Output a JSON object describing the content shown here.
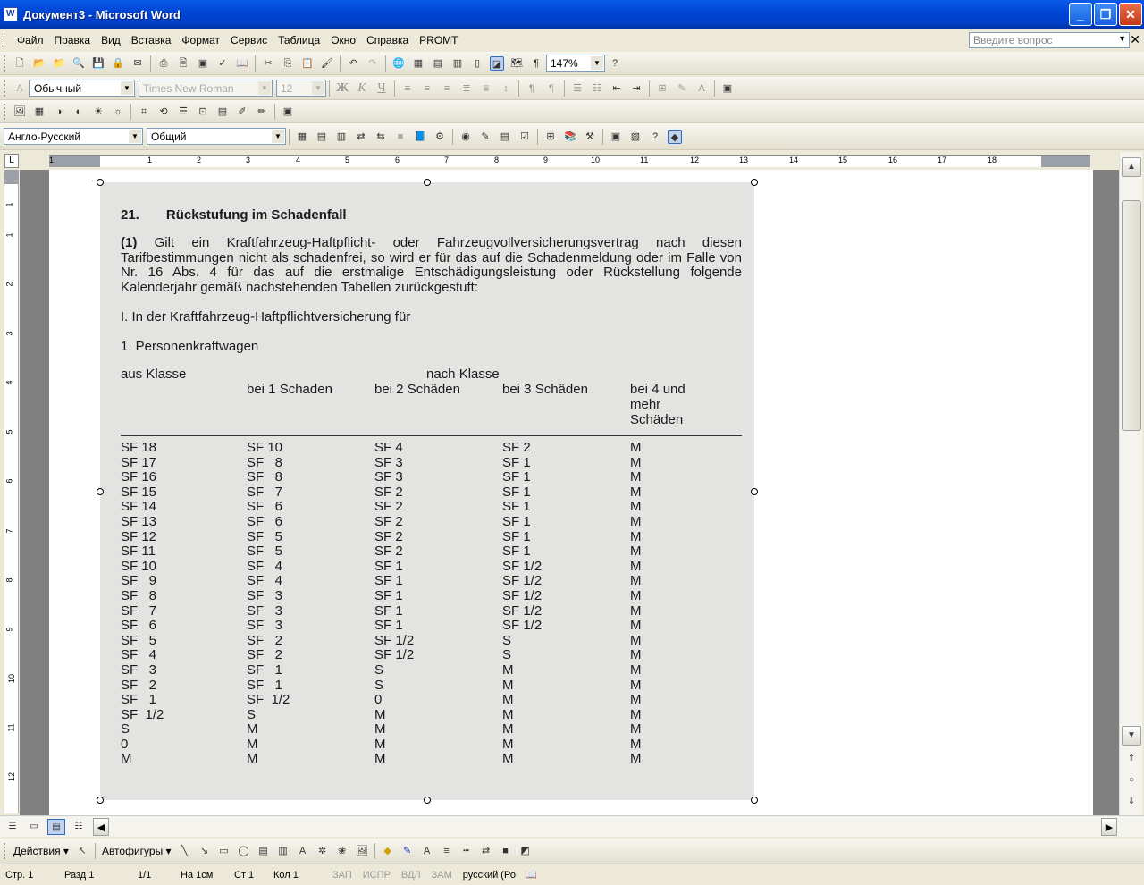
{
  "window": {
    "title": "Документ3 - Microsoft Word"
  },
  "menu": {
    "items": [
      "Файл",
      "Правка",
      "Вид",
      "Вставка",
      "Формат",
      "Сервис",
      "Таблица",
      "Окно",
      "Справка",
      "PROMT"
    ],
    "help_placeholder": "Введите вопрос"
  },
  "toolbar": {
    "zoom": "147%",
    "style": "Обычный",
    "font": "Times New Roman",
    "size": "12",
    "bold": "Ж",
    "italic": "К",
    "underline": "Ч",
    "translate_direction": "Англо-Русский",
    "dictionary": "Общий"
  },
  "ruler": {
    "numbers": [
      "1",
      "1",
      "2",
      "3",
      "4",
      "5",
      "6",
      "7",
      "8",
      "9",
      "10",
      "11",
      "12",
      "13",
      "14",
      "15",
      "16",
      "17",
      "18"
    ],
    "vnumbers": [
      "1",
      "1",
      "2",
      "3",
      "4",
      "5",
      "6",
      "7",
      "8",
      "9",
      "10",
      "11",
      "12"
    ]
  },
  "document": {
    "section_number": "21.",
    "section_title": "Rückstufung im Schadenfall",
    "para_label": "(1)",
    "para_text": "Gilt ein Kraftfahrzeug-Haftpflicht- oder Fahrzeugvollversicherungsvertrag nach diesen Tarifbestimmungen nicht als schadenfrei, so wird er für das auf die Schadenmeldung oder im Falle von Nr. 16 Abs. 4 für das auf die erstmalige Entschädigungsleistung oder Rückstellung folgende Kalenderjahr gemäß nachstehenden Tabellen zurückgestuft:",
    "heading_1": "I. In der Kraftfahrzeug-Haftpflichtversicherung für",
    "heading_2": "1. Personenkraftwagen",
    "col_from": "aus Klasse",
    "col_to": "nach Klasse",
    "col_1": "bei 1 Schaden",
    "col_2": "bei 2 Schäden",
    "col_3": "bei 3 Schäden",
    "col_4_line1": "bei 4 und",
    "col_4_line2": "mehr",
    "col_4_line3": "Schäden",
    "rows": [
      [
        "SF 18",
        "SF 10",
        "SF 4",
        "SF 2",
        "M"
      ],
      [
        "SF 17",
        "SF   8",
        "SF 3",
        "SF 1",
        "M"
      ],
      [
        "SF 16",
        "SF   8",
        "SF 3",
        "SF 1",
        "M"
      ],
      [
        "SF 15",
        "SF   7",
        "SF 2",
        "SF 1",
        "M"
      ],
      [
        "SF 14",
        "SF   6",
        "SF 2",
        "SF 1",
        "M"
      ],
      [
        "SF 13",
        "SF   6",
        "SF 2",
        "SF 1",
        "M"
      ],
      [
        "SF 12",
        "SF   5",
        "SF 2",
        "SF 1",
        "M"
      ],
      [
        "SF 11",
        "SF   5",
        "SF 2",
        "SF 1",
        "M"
      ],
      [
        "SF 10",
        "SF   4",
        "SF 1",
        "SF 1/2",
        "M"
      ],
      [
        "SF   9",
        "SF   4",
        "SF 1",
        "SF 1/2",
        "M"
      ],
      [
        "SF   8",
        "SF   3",
        "SF 1",
        "SF 1/2",
        "M"
      ],
      [
        "SF   7",
        "SF   3",
        "SF 1",
        "SF 1/2",
        "M"
      ],
      [
        "SF   6",
        "SF   3",
        "SF 1",
        "SF 1/2",
        "M"
      ],
      [
        "SF   5",
        "SF   2",
        "SF 1/2",
        "S",
        "M"
      ],
      [
        "SF   4",
        "SF   2",
        "SF 1/2",
        "S",
        "M"
      ],
      [
        "SF   3",
        "SF   1",
        "S",
        "M",
        "M"
      ],
      [
        "SF   2",
        "SF   1",
        "S",
        "M",
        "M"
      ],
      [
        "SF   1",
        "SF  1/2",
        "0",
        "M",
        "M"
      ],
      [
        "SF  1/2",
        "S",
        "M",
        "M",
        "M"
      ],
      [
        "S",
        "M",
        "M",
        "M",
        "M"
      ],
      [
        "0",
        "M",
        "M",
        "M",
        "M"
      ],
      [
        "M",
        "M",
        "M",
        "M",
        "M"
      ]
    ]
  },
  "drawing_toolbar": {
    "actions": "Действия",
    "autoshapes": "Автофигуры"
  },
  "status": {
    "page": "Стр. 1",
    "section": "Разд 1",
    "pages": "1/1",
    "at": "На 1см",
    "line": "Ст 1",
    "col": "Кол 1",
    "rec": "ЗАП",
    "trk": "ИСПР",
    "ext": "ВДЛ",
    "ovr": "ЗАМ",
    "lang": "русский (Ро"
  }
}
